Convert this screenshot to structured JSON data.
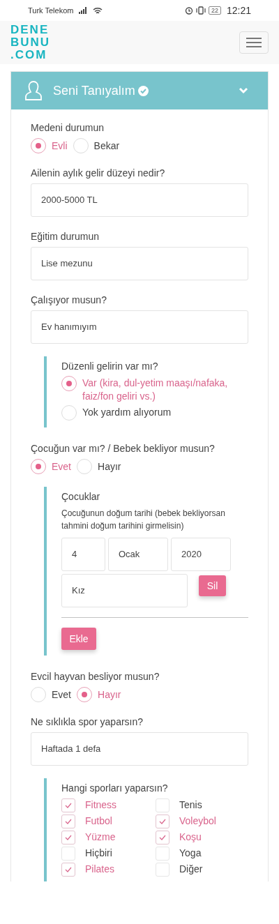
{
  "status_bar": {
    "carrier": "Turk Telekom",
    "battery": "22",
    "time": "12:21"
  },
  "navbar": {
    "logo_lines": [
      "DENE",
      "BUNU",
      ".COM"
    ]
  },
  "panel": {
    "title": "Seni Tanıyalım",
    "completed": true,
    "expanded": true
  },
  "fields": [
    {
      "kind": "radio",
      "label": "Medeni durumun",
      "options": [
        {
          "label": "Evli",
          "selected": true
        },
        {
          "label": "Bekar",
          "selected": false
        }
      ]
    },
    {
      "kind": "select",
      "label": "Ailenin aylık gelir düzeyi nedir?",
      "value": "2000-5000 TL"
    },
    {
      "kind": "select",
      "label": "Eğitim durumun",
      "value": "Lise mezunu"
    },
    {
      "kind": "select",
      "label": "Çalışıyor musun?",
      "value": "Ev hanımıyım"
    },
    {
      "kind": "group",
      "children": [
        {
          "kind": "radio-stack",
          "label": "Düzenli gelirin var mı?",
          "options": [
            {
              "label": "Var (kira, dul-yetim maaşı/nafaka, faiz/fon geliri vs.)",
              "selected": true
            },
            {
              "label": "Yok yardım alıyorum",
              "selected": false
            }
          ]
        }
      ]
    },
    {
      "kind": "radio",
      "label": "Çocuğun var mı? / Bebek bekliyor musun?",
      "options": [
        {
          "label": "Evet",
          "selected": true
        },
        {
          "label": "Hayır",
          "selected": false
        }
      ]
    },
    {
      "kind": "group",
      "children": [
        {
          "kind": "children",
          "title": "Çocuklar",
          "hint": "Çocuğunun doğum tarihi (bebek bekliyorsan tahmini doğum tarihini girmelisin)",
          "entries": [
            {
              "day": "4",
              "month": "Ocak",
              "year": "2020",
              "gender": "Kız",
              "remove": "Sil"
            }
          ],
          "add": "Ekle"
        }
      ]
    },
    {
      "kind": "radio",
      "label": "Evcil hayvan besliyor musun?",
      "options": [
        {
          "label": "Evet",
          "selected": false
        },
        {
          "label": "Hayır",
          "selected": true
        }
      ]
    },
    {
      "kind": "select",
      "label": "Ne sıklıkla spor yaparsın?",
      "value": "Haftada 1 defa"
    },
    {
      "kind": "group",
      "children": [
        {
          "kind": "checkboxes",
          "label": "Hangi sporları yaparsın?",
          "options": [
            {
              "label": "Fitness",
              "checked": true
            },
            {
              "label": "Futbol",
              "checked": true
            },
            {
              "label": "Yüzme",
              "checked": true
            },
            {
              "label": "Hiçbiri",
              "checked": false
            },
            {
              "label": "Pilates",
              "checked": true
            },
            {
              "label": "Tenis",
              "checked": false
            },
            {
              "label": "Voleybol",
              "checked": true
            },
            {
              "label": "Koşu",
              "checked": true
            },
            {
              "label": "Yoga",
              "checked": false
            },
            {
              "label": "Diğer",
              "checked": false
            }
          ]
        }
      ]
    }
  ]
}
